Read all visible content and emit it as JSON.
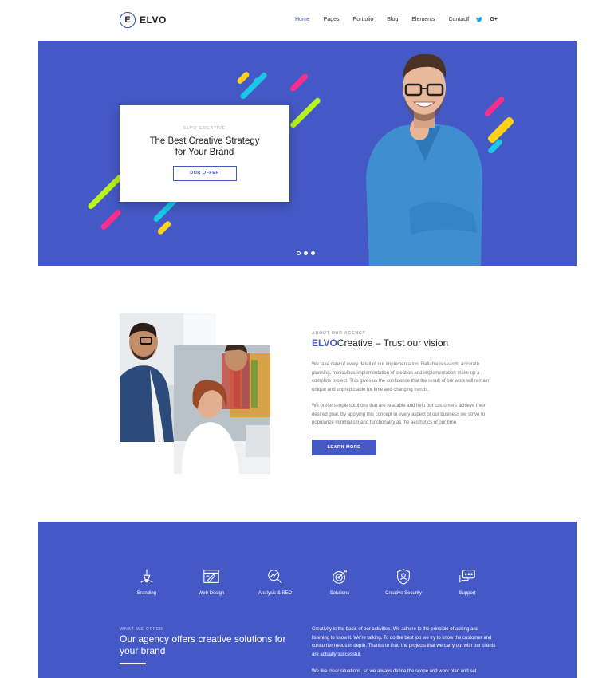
{
  "brand": {
    "logo_letter": "E",
    "name": "ELVO"
  },
  "nav": [
    {
      "label": "Home",
      "active": true
    },
    {
      "label": "Pages"
    },
    {
      "label": "Portfolio"
    },
    {
      "label": "Blog"
    },
    {
      "label": "Elements"
    },
    {
      "label": "Contact"
    }
  ],
  "social": {
    "facebook": "f",
    "twitter": "t",
    "googleplus": "G+"
  },
  "hero": {
    "eyebrow": "ELVO CREATIVE",
    "title_line1": "The Best Creative Strategy",
    "title_line2": "for Your Brand",
    "button": "OUR OFFER",
    "slides": 3,
    "active_slide": 1
  },
  "about": {
    "eyebrow": "ABOUT OUR AGENCY",
    "title_brand": "ELVO",
    "title_rest": "Creative – Trust our vision",
    "paragraph1": "We take care of every detail of our implementation. Reliable research, accurate planning, meticulous implementation of creation and implementation make up a complete project. This gives us the confidence that the result of our work will remain unique and unpredictable for time and changing trends.",
    "paragraph2": "We prefer simple solutions that are readable and help our customers achieve their desired goal. By applying this concept in every aspect of our business we strive to popularize minimalism and functionality as the aesthetics of our time.",
    "button": "LEARN MORE"
  },
  "services": [
    {
      "label": "Branding",
      "icon": "branding-icon"
    },
    {
      "label": "Web Design",
      "icon": "web-design-icon"
    },
    {
      "label": "Analysis & SEO",
      "icon": "analysis-seo-icon"
    },
    {
      "label": "Solutions",
      "icon": "solutions-icon"
    },
    {
      "label": "Creative Security",
      "icon": "security-icon"
    },
    {
      "label": "Support",
      "icon": "support-icon"
    }
  ],
  "offer": {
    "eyebrow": "WHAT WE OFFER",
    "title": "Our agency offers creative solutions for your brand",
    "paragraph1": "Creativity is the basis of our activities. We adhere to the principle of asking and listening to know it. We're talking. To do the best job we try to know the customer and consumer needs in depth. Thanks to that, the projects that we carry out with our clients are actually successful.",
    "paragraph2": "We like clear situations, so we always define the scope and work plan and set"
  },
  "colors": {
    "primary": "#4559c6",
    "accent_cyan": "#1ac9e6",
    "accent_pink": "#ff2d8a",
    "accent_lime": "#b9f21d",
    "accent_yellow": "#ffd21a"
  }
}
